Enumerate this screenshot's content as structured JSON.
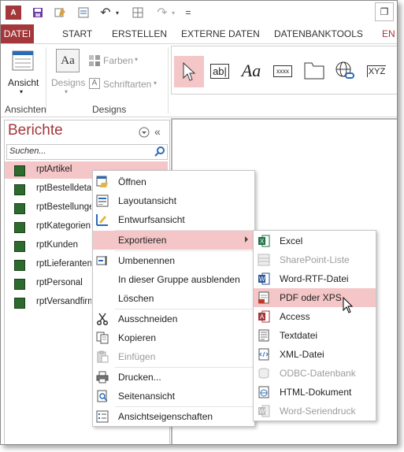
{
  "qat": {
    "logo": "A",
    "undo": "↶",
    "redo": "↷",
    "customize": "="
  },
  "tabs": [
    {
      "label": "DATEI"
    },
    {
      "label": "START"
    },
    {
      "label": "ERSTELLEN"
    },
    {
      "label": "EXTERNE DATEN"
    },
    {
      "label": "DATENBANKTOOLS"
    },
    {
      "label": "EN"
    }
  ],
  "ribbon": {
    "views_label": "Ansicht",
    "views_group": "Ansichten",
    "designs_label": "Designs",
    "colors_label": "Farben",
    "fonts_label": "Schriftarten",
    "designs_group": "Designs",
    "gallery": [
      {
        "icon": "pointer-icon"
      },
      {
        "icon": "textbox-icon",
        "text": "ab|"
      },
      {
        "icon": "label-icon",
        "text": "Aa"
      },
      {
        "icon": "button-icon",
        "text": "xxxx"
      },
      {
        "icon": "tab-control-icon"
      },
      {
        "icon": "hyperlink-icon"
      },
      {
        "icon": "chart-icon",
        "text": "XYZ"
      }
    ]
  },
  "nav": {
    "title": "Berichte",
    "search_placeholder": "Suchen...",
    "items": [
      {
        "label": "rptArtikel"
      },
      {
        "label": "rptBestelldetails"
      },
      {
        "label": "rptBestellungen"
      },
      {
        "label": "rptKategorien"
      },
      {
        "label": "rptKunden"
      },
      {
        "label": "rptLieferanten"
      },
      {
        "label": "rptPersonal"
      },
      {
        "label": "rptVersandfirmen"
      }
    ]
  },
  "context_menu": [
    {
      "label": "Öffnen",
      "icon": "open-icon"
    },
    {
      "label": "Layoutansicht",
      "icon": "layout-view-icon"
    },
    {
      "label": "Entwurfsansicht",
      "icon": "design-view-icon"
    },
    {
      "label": "Exportieren",
      "icon": "",
      "submenu": true
    },
    {
      "label": "Umbenennen",
      "icon": "rename-icon"
    },
    {
      "label": "In dieser Gruppe ausblenden",
      "icon": ""
    },
    {
      "label": "Löschen",
      "icon": ""
    },
    {
      "label": "Ausschneiden",
      "icon": "cut-icon"
    },
    {
      "label": "Kopieren",
      "icon": "copy-icon"
    },
    {
      "label": "Einfügen",
      "icon": "paste-icon",
      "disabled": true
    },
    {
      "label": "Drucken...",
      "icon": "print-icon"
    },
    {
      "label": "Seitenansicht",
      "icon": "print-preview-icon"
    },
    {
      "label": "Ansichtseigenschaften",
      "icon": "properties-icon"
    }
  ],
  "export_menu": [
    {
      "label": "Excel",
      "icon": "excel-icon"
    },
    {
      "label": "SharePoint-Liste",
      "icon": "sharepoint-icon",
      "disabled": true
    },
    {
      "label": "Word-RTF-Datei",
      "icon": "word-icon"
    },
    {
      "label": "PDF oder XPS",
      "icon": "pdf-icon"
    },
    {
      "label": "Access",
      "icon": "access-icon"
    },
    {
      "label": "Textdatei",
      "icon": "text-file-icon"
    },
    {
      "label": "XML-Datei",
      "icon": "xml-icon"
    },
    {
      "label": "ODBC-Datenbank",
      "icon": "odbc-icon",
      "disabled": true
    },
    {
      "label": "HTML-Dokument",
      "icon": "html-icon"
    },
    {
      "label": "Word-Seriendruck",
      "icon": "mail-merge-icon",
      "disabled": true
    }
  ],
  "colors": {
    "accent": "#a4373a",
    "highlight": "#f4c6c8",
    "report_icon": "#2d6a2d"
  }
}
